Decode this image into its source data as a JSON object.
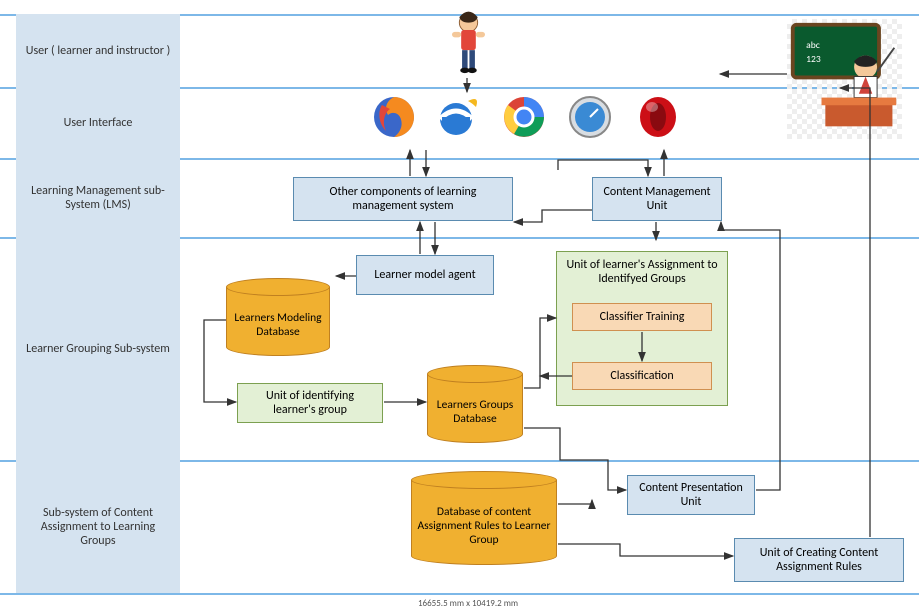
{
  "rows": {
    "r1": "User ( learner and instructor )",
    "r2": "User Interface",
    "r3": "Learning Management sub-System (LMS)",
    "r4": "Learner Grouping Sub-system",
    "r5": "Sub-system of Content Assignment to Learning Groups"
  },
  "boxes": {
    "other_lms": "Other components of learning management system",
    "cmu": "Content Management Unit",
    "lma": "Learner model agent",
    "uig": "Unit of identifying learner's group",
    "ulag": "Unit of learner's Assignment to Identifyed Groups",
    "ct": "Classifier Training",
    "cls": "Classification",
    "cpu": "Content Presentation Unit",
    "uccar": "Unit of Creating Content Assignment Rules"
  },
  "cyls": {
    "lmdb": "Learners Modeling Database",
    "lgdb": "Learners Groups Database",
    "dcarg": "Database of content Assignment Rules to Learner Group"
  },
  "icons": {
    "learner": "learner-child-icon",
    "teacher": "teacher-instructor-icon",
    "firefox": "firefox-browser-icon",
    "ie": "internet-explorer-browser-icon",
    "chrome": "chrome-browser-icon",
    "safari": "safari-browser-icon",
    "opera": "opera-browser-icon"
  },
  "footer_dim": "16655.5 mm x 10419.2 mm"
}
